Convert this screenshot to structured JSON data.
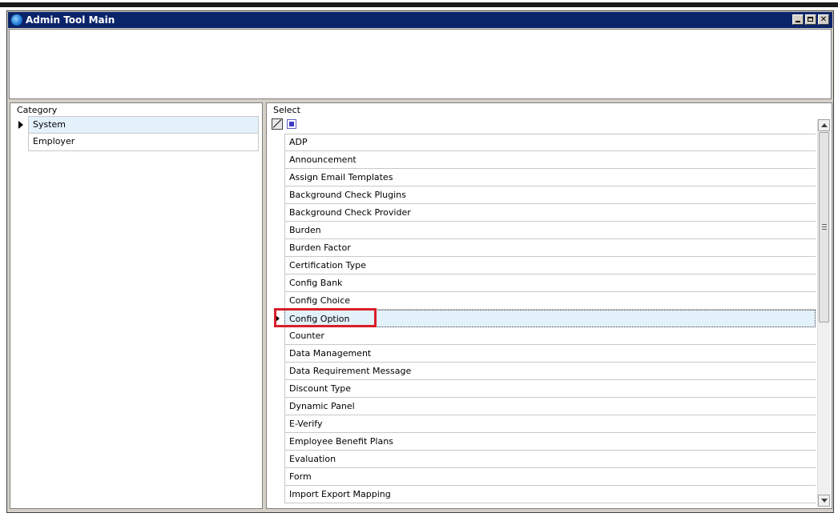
{
  "window": {
    "title": "Admin Tool Main",
    "icon": "app-logo-icon",
    "controls": [
      "minimize-icon",
      "maximize-icon",
      "close-icon"
    ]
  },
  "category": {
    "label": "Category",
    "items": [
      {
        "label": "System",
        "selected": true
      },
      {
        "label": "Employer",
        "selected": false
      }
    ]
  },
  "select": {
    "label": "Select",
    "header_icons": [
      "resize-columns-icon",
      "select-all-icon"
    ],
    "items": [
      "ADP",
      "Announcement",
      "Assign Email Templates",
      "Background Check Plugins",
      "Background Check Provider",
      "Burden",
      "Burden Factor",
      "Certification Type",
      "Config Bank",
      "Config Choice",
      "Config Option",
      "Counter",
      "Data Management",
      "Data Requirement Message",
      "Discount Type",
      "Dynamic Panel",
      "E-Verify",
      "Employee Benefit Plans",
      "Evaluation",
      "Form",
      "Import Export Mapping"
    ],
    "selected_item": "Config Option"
  },
  "colors": {
    "titlebar": "#0a246a",
    "selection": "#e3f1fb",
    "highlight": "#d81e2a"
  }
}
